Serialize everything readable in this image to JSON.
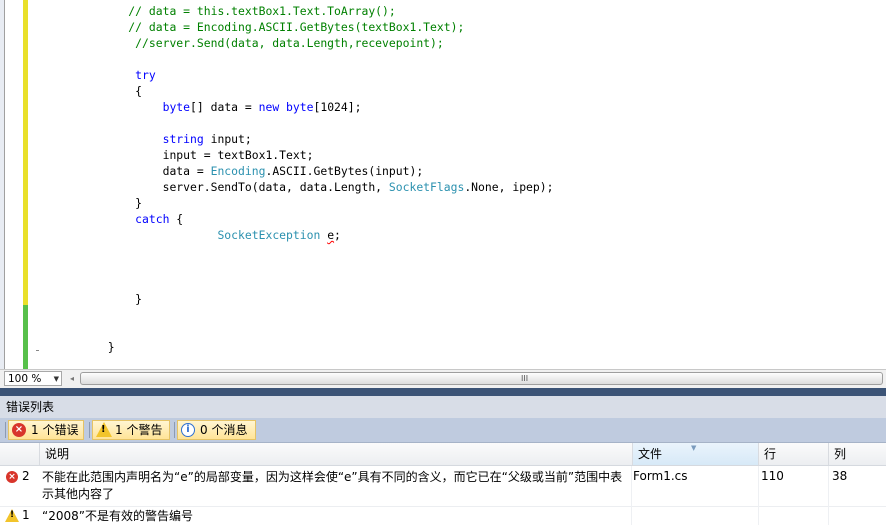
{
  "editor": {
    "lines": [
      [
        {
          "t": "            "
        },
        {
          "t": "// data = this.textBox1.Text.ToArray();",
          "c": "cm"
        }
      ],
      [
        {
          "t": "            "
        },
        {
          "t": "// data = Encoding.ASCII.GetBytes(textBox1.Text);",
          "c": "cm"
        }
      ],
      [
        {
          "t": "             "
        },
        {
          "t": "//server.Send(data, data.Length,recevepoint);",
          "c": "cm"
        }
      ],
      [
        {
          "t": ""
        }
      ],
      [
        {
          "t": "             "
        },
        {
          "t": "try",
          "c": "kw"
        }
      ],
      [
        {
          "t": "             {"
        }
      ],
      [
        {
          "t": "                 "
        },
        {
          "t": "byte",
          "c": "kw"
        },
        {
          "t": "[] data = "
        },
        {
          "t": "new",
          "c": "kw"
        },
        {
          "t": " "
        },
        {
          "t": "byte",
          "c": "kw"
        },
        {
          "t": "[1024];"
        }
      ],
      [
        {
          "t": ""
        }
      ],
      [
        {
          "t": "                 "
        },
        {
          "t": "string",
          "c": "kw"
        },
        {
          "t": " input;"
        }
      ],
      [
        {
          "t": "                 input = textBox1.Text;"
        }
      ],
      [
        {
          "t": "                 data = "
        },
        {
          "t": "Encoding",
          "c": "ty"
        },
        {
          "t": ".ASCII.GetBytes(input);"
        }
      ],
      [
        {
          "t": "                 server.SendTo(data, data.Length, "
        },
        {
          "t": "SocketFlags",
          "c": "ty"
        },
        {
          "t": ".None, ipep);"
        }
      ],
      [
        {
          "t": "             }"
        }
      ],
      [
        {
          "t": "             "
        },
        {
          "t": "catch",
          "c": "kw"
        },
        {
          "t": " {"
        }
      ],
      [
        {
          "t": "                         "
        },
        {
          "t": "SocketException",
          "c": "ty"
        },
        {
          "t": " "
        },
        {
          "t": "e",
          "c": "err"
        },
        {
          "t": ";"
        }
      ],
      [
        {
          "t": ""
        }
      ],
      [
        {
          "t": ""
        }
      ],
      [
        {
          "t": ""
        }
      ],
      [
        {
          "t": "             }"
        }
      ],
      [
        {
          "t": ""
        }
      ],
      [
        {
          "t": ""
        }
      ],
      [
        {
          "t": "         }"
        }
      ]
    ]
  },
  "zoom": {
    "value": "100 %",
    "grip": "III"
  },
  "error_list": {
    "title": "错误列表",
    "filters": {
      "errors": "1 个错误",
      "warnings": "1 个警告",
      "messages": "0 个消息"
    },
    "columns": {
      "description": "说明",
      "file": "文件",
      "line": "行",
      "column": "列"
    },
    "rows": [
      {
        "num": "2",
        "description": "不能在此范围内声明名为“e”的局部变量，因为这样会使“e”具有不同的含义，而它已在“父级或当前”范围中表示其他内容了",
        "file": "Form1.cs",
        "line": "110",
        "column": "38"
      },
      {
        "num": "1",
        "description": "“2008”不是有效的警告编号",
        "file": "",
        "line": "",
        "column": ""
      }
    ]
  }
}
